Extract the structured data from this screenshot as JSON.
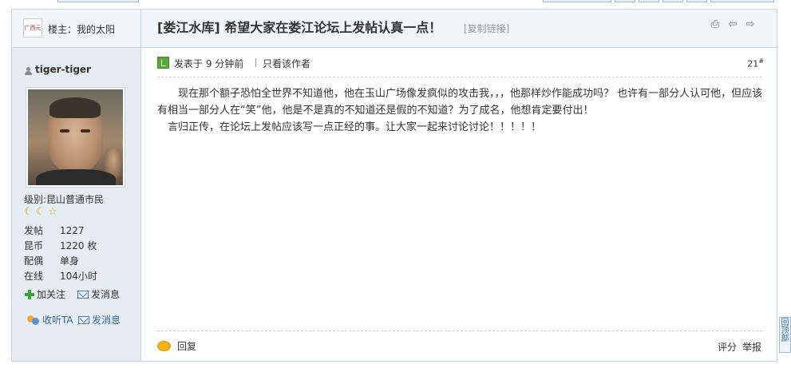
{
  "host": {
    "avatar_text": "广西元",
    "label": "楼主：我的太阳"
  },
  "user": {
    "name": "tiger-tiger",
    "level_label": "级别:",
    "level_value": "昆山普通市民",
    "stats": [
      {
        "key": "发帖",
        "value": "1227"
      },
      {
        "key": "昆币",
        "value": "1220 枚"
      },
      {
        "key": "配偶",
        "value": "单身"
      },
      {
        "key": "在线",
        "value": "104小时"
      }
    ],
    "follow": "加关注",
    "message": "发消息",
    "listen": "收听TA",
    "message2": "发消息"
  },
  "thread": {
    "title": "[娄江水库] 希望大家在娄江论坛上发帖认真一点！",
    "copy_link": "[复制链接]"
  },
  "post": {
    "posted": "发表于 9 分钟前",
    "only_author": "只看该作者",
    "floor": "21",
    "floor_sup": "#",
    "paragraphs": [
      "现在那个额子恐怕全世界不知道他，他在玉山广场像发疯似的攻击我，，，他那样炒作能成功吗？  也许有一部分人认可他，但应该有相当一部分人在“笑”他，他是不是真的不知道还是假的不知道？为了成名，他想肯定要付出！",
      "言归正传，在论坛上发帖应该写一点正经的事。让大家一起来讨论讨论！！！！！"
    ],
    "reply": "回复",
    "rate": "评分",
    "report": "举报"
  },
  "to_top": "回顶部",
  "colors": {
    "border": "#c2d5e3",
    "sidebar_bg": "#e5edf2",
    "header_bg": "#f3f6f9",
    "link_blue": "#336699"
  },
  "icons": [
    "user-icon",
    "moon-icon",
    "star-icon",
    "plus-icon",
    "mail-icon",
    "listen-icon",
    "print-icon",
    "prev-icon",
    "next-icon",
    "status-icon",
    "reply-icon"
  ]
}
